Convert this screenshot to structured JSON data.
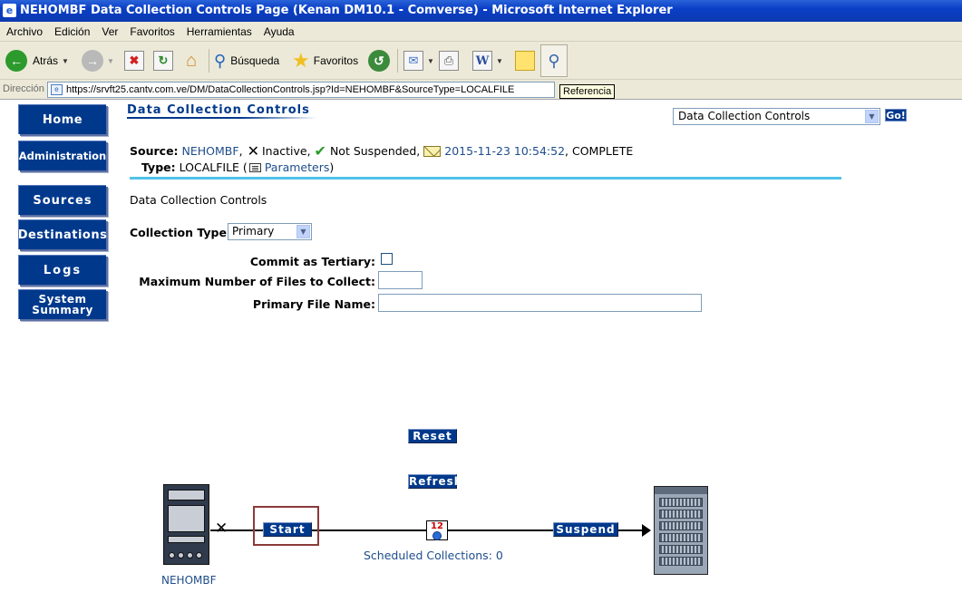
{
  "window": {
    "title": "NEHOMBF Data Collection Controls Page (Kenan DM10.1 - Comverse) - Microsoft Internet Explorer"
  },
  "menu": [
    "Archivo",
    "Edición",
    "Ver",
    "Favoritos",
    "Herramientas",
    "Ayuda"
  ],
  "toolbar": {
    "back_label": "Atrás",
    "search_label": "Búsqueda",
    "favorites_label": "Favoritos"
  },
  "address": {
    "label": "Dirección",
    "url": "https://srvft25.cantv.com.ve/DM/DataCollectionControls.jsp?Id=NEHOMBF&SourceType=LOCALFILE",
    "tooltip": "Referencia"
  },
  "nav": {
    "home": "Home",
    "administration": "Administration",
    "sources": "Sources",
    "destinations": "Destinations",
    "logs": "Logs",
    "system_line1": "System",
    "system_line2": "Summary"
  },
  "header": {
    "title": "Data Collection Controls",
    "goto_selected": "Data Collection Controls",
    "go_label": "Go!"
  },
  "source_info": {
    "source_label": "Source:",
    "source_name": "NEHOMBF",
    "inactive_text": "Inactive,",
    "not_suspended_text": "Not Suspended,",
    "last_event_time": "2015-11-23 10:54:52",
    "last_event_status": ", COMPLETE",
    "type_label": "Type:",
    "type_value": "LOCALFILE",
    "parameters_link": "Parameters"
  },
  "form": {
    "section_title": "Data Collection Controls",
    "collection_type_label": "Collection Type:",
    "collection_type_value": "Primary",
    "commit_tertiary_label": "Commit as Tertiary:",
    "max_files_label": "Maximum Number of Files to Collect:",
    "max_files_value": "",
    "primary_file_label": "Primary File Name:",
    "primary_file_value": ""
  },
  "actions": {
    "reset": "Reset",
    "refresh": "Refresh",
    "start": "Start",
    "suspend": "Suspend"
  },
  "flow": {
    "source_node_label": "NEHOMBF",
    "clock_digits": "12",
    "scheduled_label": "Scheduled Collections: 0"
  }
}
